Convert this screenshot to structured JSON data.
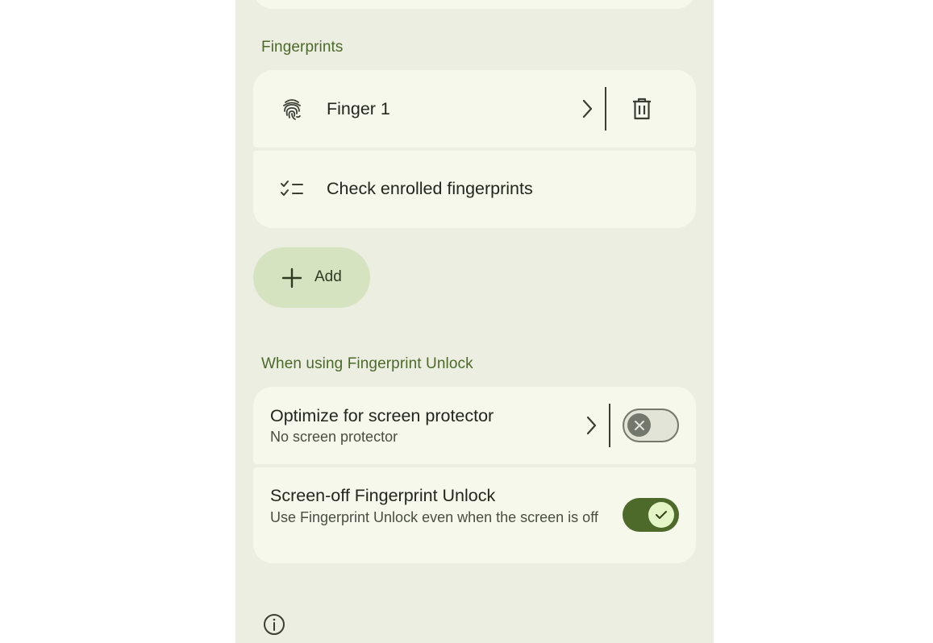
{
  "sections": {
    "fingerprints_title": "Fingerprints",
    "unlock_title": "When using Fingerprint Unlock"
  },
  "fingerprints": {
    "finger1_label": "Finger 1",
    "check_label": "Check enrolled fingerprints"
  },
  "add_button": {
    "label": "Add"
  },
  "unlock": {
    "protector_title": "Optimize for screen protector",
    "protector_summary": "No screen protector",
    "protector_enabled": false,
    "screenoff_title": "Screen-off Fingerprint Unlock",
    "screenoff_summary": "Use Fingerprint Unlock even when the screen is off",
    "screenoff_enabled": true
  },
  "colors": {
    "background": "#ebeee0",
    "card": "#f5f8ea",
    "accent": "#4d6a2b",
    "section_title": "#4c6a2a",
    "add_button": "#d6e3c0"
  }
}
